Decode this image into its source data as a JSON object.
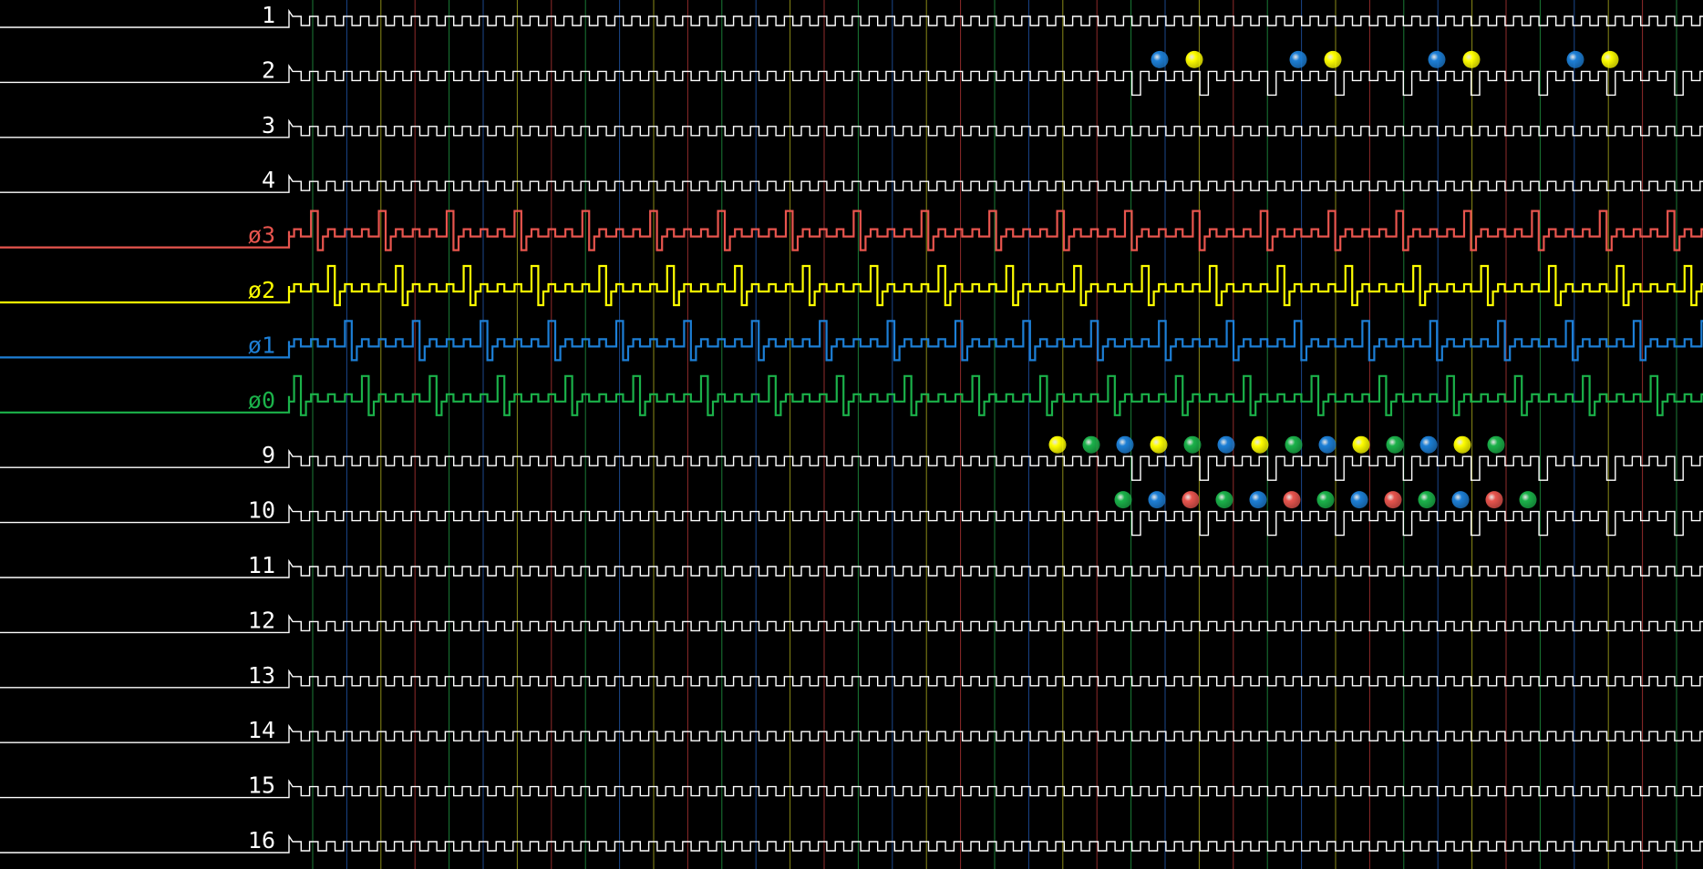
{
  "colors": {
    "background": "#000000",
    "trace_default": "#ffffff",
    "phase3": "#e8554e",
    "phase2": "#ffff00",
    "phase1": "#1d7fd6",
    "phase0": "#1bb24a",
    "grid_green": "#1e8a3c",
    "grid_blue": "#1e4f9c",
    "grid_yellow": "#9a9a1a",
    "grid_red": "#a03030"
  },
  "channels": [
    {
      "label": "1",
      "color": "#ffffff",
      "kind": "clock"
    },
    {
      "label": "2",
      "color": "#ffffff",
      "kind": "clock_active"
    },
    {
      "label": "3",
      "color": "#ffffff",
      "kind": "clock"
    },
    {
      "label": "4",
      "color": "#ffffff",
      "kind": "clock"
    },
    {
      "label": "ø3",
      "color": "#e8554e",
      "kind": "phase",
      "phase": 3
    },
    {
      "label": "ø2",
      "color": "#ffff00",
      "kind": "phase",
      "phase": 2
    },
    {
      "label": "ø1",
      "color": "#1d7fd6",
      "kind": "phase",
      "phase": 1
    },
    {
      "label": "ø0",
      "color": "#1bb24a",
      "kind": "phase",
      "phase": 0
    },
    {
      "label": "9",
      "color": "#ffffff",
      "kind": "clock_active"
    },
    {
      "label": "10",
      "color": "#ffffff",
      "kind": "clock_active"
    },
    {
      "label": "11",
      "color": "#ffffff",
      "kind": "clock"
    },
    {
      "label": "12",
      "color": "#ffffff",
      "kind": "clock"
    },
    {
      "label": "13",
      "color": "#ffffff",
      "kind": "clock"
    },
    {
      "label": "14",
      "color": "#ffffff",
      "kind": "clock"
    },
    {
      "label": "15",
      "color": "#ffffff",
      "kind": "clock"
    },
    {
      "label": "16",
      "color": "#ffffff",
      "kind": "clock"
    }
  ],
  "gridline_color_cycle": [
    "green",
    "blue",
    "yellow",
    "red"
  ],
  "markers": [
    {
      "channel": 2,
      "colors": [
        "blue",
        "yellow",
        "blue",
        "yellow",
        "blue",
        "yellow",
        "blue",
        "yellow"
      ]
    },
    {
      "channel": 9,
      "colors": [
        "yellow",
        "green",
        "blue",
        "yellow",
        "green",
        "blue",
        "yellow",
        "green",
        "blue",
        "yellow",
        "green",
        "blue",
        "yellow",
        "green"
      ]
    },
    {
      "channel": 10,
      "colors": [
        "green",
        "blue",
        "red",
        "green",
        "blue",
        "red",
        "green",
        "blue",
        "red",
        "green",
        "blue",
        "red",
        "green"
      ]
    }
  ]
}
